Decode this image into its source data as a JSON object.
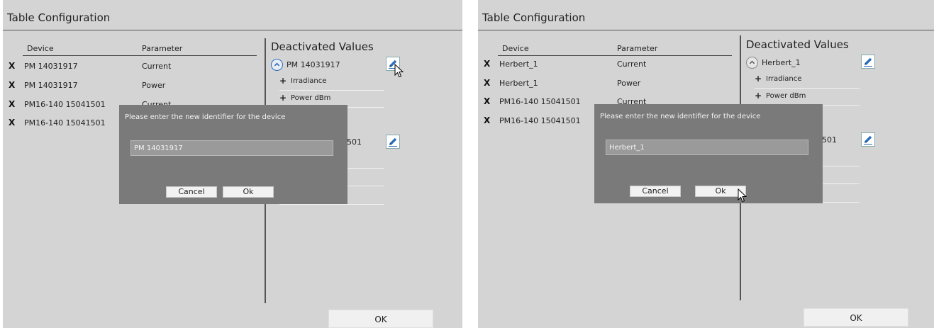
{
  "panels": [
    {
      "title": "Table Configuration",
      "columns": {
        "device": "Device",
        "parameter": "Parameter"
      },
      "rows": [
        {
          "remove": "X",
          "device": "PM 14031917",
          "parameter": "Current"
        },
        {
          "remove": "X",
          "device": "PM 14031917",
          "parameter": "Power"
        },
        {
          "remove": "X",
          "device": "PM16-140 15041501",
          "parameter": "Current"
        },
        {
          "remove": "X",
          "device": "PM16-140 15041501",
          "parameter": ""
        }
      ],
      "deactivated": {
        "title": "Deactivated Values",
        "device_name": "PM 14031917",
        "items": [
          {
            "sign": "+",
            "label": "Irradiance"
          },
          {
            "sign": "+",
            "label": "Power dBm"
          }
        ],
        "second_device_fragment": "501"
      },
      "ok_label": "OK",
      "dialog": {
        "prompt": "Please enter the new identifier for the device",
        "value": "PM 14031917",
        "cancel": "Cancel",
        "ok": "Ok"
      }
    },
    {
      "title": "Table Configuration",
      "columns": {
        "device": "Device",
        "parameter": "Parameter"
      },
      "rows": [
        {
          "remove": "X",
          "device": "Herbert_1",
          "parameter": "Current"
        },
        {
          "remove": "X",
          "device": "Herbert_1",
          "parameter": "Power"
        },
        {
          "remove": "X",
          "device": "PM16-140 15041501",
          "parameter": "Current"
        },
        {
          "remove": "X",
          "device": "PM16-140 15041501",
          "parameter": ""
        }
      ],
      "deactivated": {
        "title": "Deactivated Values",
        "device_name": "Herbert_1",
        "items": [
          {
            "sign": "+",
            "label": "Irradiance"
          },
          {
            "sign": "+",
            "label": "Power dBm"
          }
        ],
        "second_device_fragment": "501"
      },
      "ok_label": "OK",
      "dialog": {
        "prompt": "Please enter the new identifier for the device",
        "value": "Herbert_1",
        "cancel": "Cancel",
        "ok": "Ok"
      }
    }
  ],
  "icons": {
    "remove": "close-x-icon",
    "collapse": "chevron-up-circle-icon",
    "edit": "pencil-edit-icon",
    "cursor": "mouse-pointer-icon"
  },
  "colors": {
    "panel_bg": "#d4d4d4",
    "dialog_bg": "#7a7a7a",
    "input_bg": "#9a9a9a",
    "accent": "#2a6ebb"
  }
}
